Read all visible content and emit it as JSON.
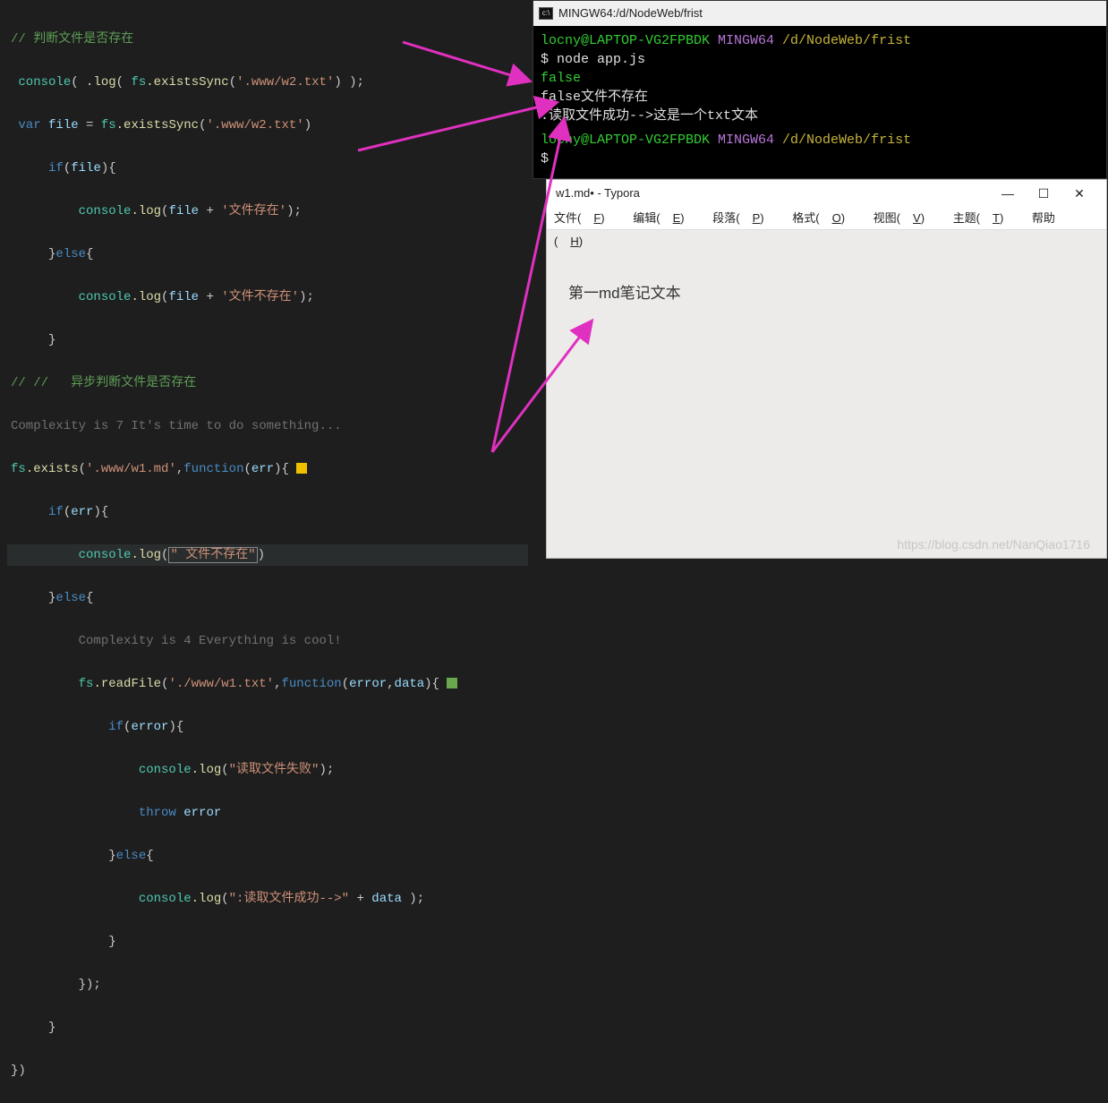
{
  "editor": {
    "l1_comment": "// 判断文件是否存在",
    "l2_a": "console",
    "l2_b": ".log",
    "l2_c": "( ",
    "l2_fs": "fs",
    "l2_d": ".existsSync",
    "l2_e": "(",
    "l2_str": "'.www/w2.txt'",
    "l2_f": ") );",
    "l3_var": "var ",
    "l3_file": "file",
    "l3_eq": " = ",
    "l3_fs": "fs",
    "l3_fn": ".existsSync",
    "l3_p": "(",
    "l3_str": "'.www/w2.txt'",
    "l3_end": ")",
    "l4_if": "if",
    "l4_p": "(",
    "l4_file": "file",
    "l4_pe": "){",
    "l5_con": "console",
    "l5_log": ".log",
    "l5_p": "(",
    "l5_file": "file",
    "l5_plus": " + ",
    "l5_str": "'文件存在'",
    "l5_end": ");",
    "l6": "}",
    "l6_else": "else",
    "l6_b": "{",
    "l7_con": "console",
    "l7_log": ".log",
    "l7_p": "(",
    "l7_file": "file",
    "l7_plus": " + ",
    "l7_str": "'文件不存在'",
    "l7_end": ");",
    "l8": "}",
    "l9_comment": "// //   异步判断文件是否存在",
    "l10_hint": "Complexity is 7 It's time to do something...",
    "l11_fs": "fs",
    "l11_ex": ".exists",
    "l11_p": "(",
    "l11_str": "'.www/w1.md'",
    "l11_c": ",",
    "l11_fn": "function",
    "l11_pp": "(",
    "l11_err": "err",
    "l11_end": "){ ",
    "l12_if": "if",
    "l12_p": "(",
    "l12_err": "err",
    "l12_end": "){",
    "l13_con": "console",
    "l13_log": ".log",
    "l13_p": "(",
    "l13_str": "\" 文件不存在\"",
    "l13_end": ")",
    "l14": "}",
    "l14_else": "else",
    "l14_b": "{",
    "l15_hint": "Complexity is 4 Everything is cool!",
    "l16_fs": "fs",
    "l16_rf": ".readFile",
    "l16_p": "(",
    "l16_str": "'./www/w1.txt'",
    "l16_c": ",",
    "l16_fn": "function",
    "l16_pp": "(",
    "l16_er": "error",
    "l16_cm": ",",
    "l16_da": "data",
    "l16_end": "){ ",
    "l17_if": "if",
    "l17_p": "(",
    "l17_er": "error",
    "l17_end": "){",
    "l18_con": "console",
    "l18_log": ".log",
    "l18_p": "(",
    "l18_str": "\"读取文件失败\"",
    "l18_end": ");",
    "l19_th": "throw ",
    "l19_er": "error",
    "l20": "}",
    "l20_else": "else",
    "l20_b": "{",
    "l21_con": "console",
    "l21_log": ".log",
    "l21_p": "(",
    "l21_str": "\":读取文件成功-->\"",
    "l21_plus": " + ",
    "l21_da": "data",
    "l21_end": " );",
    "l22": "}",
    "l23": "});",
    "l24": "}",
    "l25": "})"
  },
  "terminal": {
    "title": "MINGW64:/d/NodeWeb/frist",
    "p1_user": "locny@LAPTOP-VG2FPBDK",
    "p1_ming": " MINGW64 ",
    "p1_path": "/d/NodeWeb/frist",
    "cmd": "$ node app.js",
    "o1": "false",
    "o2": "false文件不存在",
    "o3": ":读取文件成功-->这是一个txt文本",
    "p2_user": "locny@LAPTOP-VG2FPBDK",
    "p2_ming": " MINGW64 ",
    "p2_path": "/d/NodeWeb/frist",
    "prompt": "$"
  },
  "typora": {
    "title": "w1.md• - Typora",
    "menu": {
      "file": "文件(",
      "file_u": "F",
      "file_e": ")",
      "edit": "编辑(",
      "edit_u": "E",
      "edit_e": ")",
      "para": "段落(",
      "para_u": "P",
      "para_e": ")",
      "fmt": "格式(",
      "fmt_u": "O",
      "fmt_e": ")",
      "view": "视图(",
      "view_u": "V",
      "view_e": ")",
      "theme": "主题(",
      "theme_u": "T",
      "theme_e": ")",
      "help": "帮助(",
      "help_u": "H",
      "help_e": ")"
    },
    "body": "第一md笔记文本",
    "min": "—",
    "max": "☐",
    "close": "✕"
  },
  "watermark": "https://blog.csdn.net/NanQiao1716"
}
